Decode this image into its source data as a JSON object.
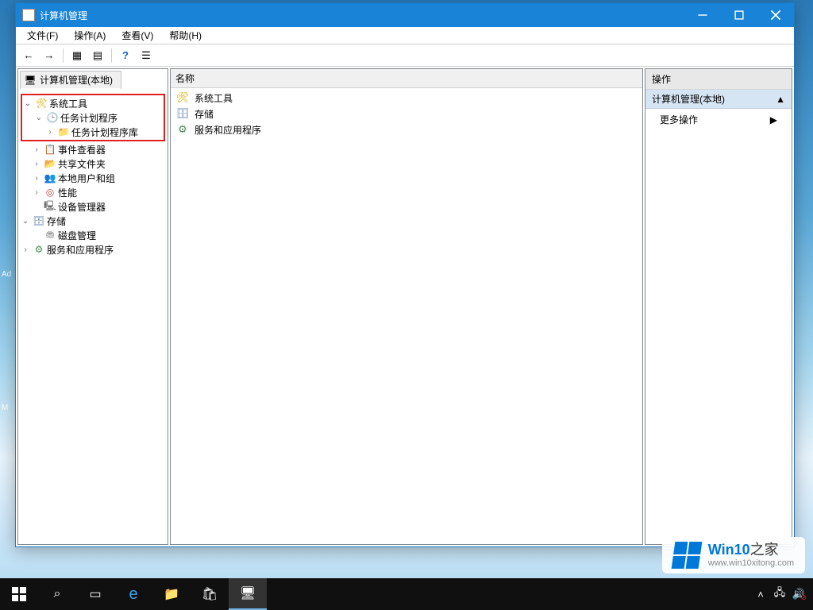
{
  "window": {
    "title": "计算机管理"
  },
  "menu": {
    "file": "文件(F)",
    "action": "操作(A)",
    "view": "查看(V)",
    "help": "帮助(H)"
  },
  "toolbar_icons": {
    "back": "←",
    "forward": "→",
    "up": "▦",
    "export": "▤",
    "help": "?",
    "props": "☰"
  },
  "tree": {
    "root": "计算机管理(本地)",
    "system_tools": "系统工具",
    "task_scheduler": "任务计划程序",
    "task_lib": "任务计划程序库",
    "event_viewer": "事件查看器",
    "shared_folders": "共享文件夹",
    "local_users": "本地用户和组",
    "performance": "性能",
    "device_manager": "设备管理器",
    "storage": "存储",
    "disk_mgmt": "磁盘管理",
    "services_apps": "服务和应用程序"
  },
  "center": {
    "header": "名称",
    "items": [
      "系统工具",
      "存储",
      "服务和应用程序"
    ]
  },
  "actions": {
    "header": "操作",
    "section": "计算机管理(本地)",
    "more": "更多操作"
  },
  "watermark": {
    "brand_a": "Win10",
    "brand_b": "之家",
    "url": "www.win10xitong.com"
  }
}
